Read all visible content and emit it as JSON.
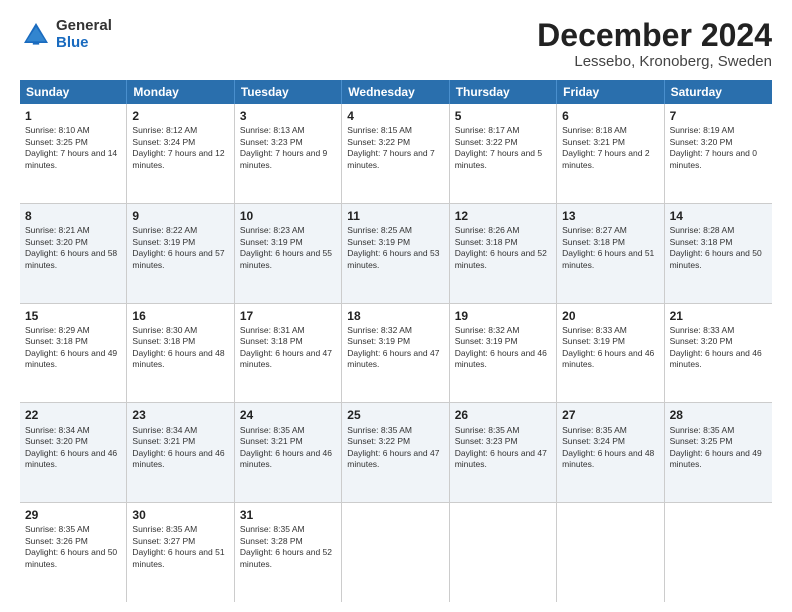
{
  "header": {
    "logo_general": "General",
    "logo_blue": "Blue",
    "title": "December 2024",
    "subtitle": "Lessebo, Kronoberg, Sweden"
  },
  "days": [
    "Sunday",
    "Monday",
    "Tuesday",
    "Wednesday",
    "Thursday",
    "Friday",
    "Saturday"
  ],
  "weeks": [
    [
      {
        "day": "1",
        "sunrise": "Sunrise: 8:10 AM",
        "sunset": "Sunset: 3:25 PM",
        "daylight": "Daylight: 7 hours and 14 minutes."
      },
      {
        "day": "2",
        "sunrise": "Sunrise: 8:12 AM",
        "sunset": "Sunset: 3:24 PM",
        "daylight": "Daylight: 7 hours and 12 minutes."
      },
      {
        "day": "3",
        "sunrise": "Sunrise: 8:13 AM",
        "sunset": "Sunset: 3:23 PM",
        "daylight": "Daylight: 7 hours and 9 minutes."
      },
      {
        "day": "4",
        "sunrise": "Sunrise: 8:15 AM",
        "sunset": "Sunset: 3:22 PM",
        "daylight": "Daylight: 7 hours and 7 minutes."
      },
      {
        "day": "5",
        "sunrise": "Sunrise: 8:17 AM",
        "sunset": "Sunset: 3:22 PM",
        "daylight": "Daylight: 7 hours and 5 minutes."
      },
      {
        "day": "6",
        "sunrise": "Sunrise: 8:18 AM",
        "sunset": "Sunset: 3:21 PM",
        "daylight": "Daylight: 7 hours and 2 minutes."
      },
      {
        "day": "7",
        "sunrise": "Sunrise: 8:19 AM",
        "sunset": "Sunset: 3:20 PM",
        "daylight": "Daylight: 7 hours and 0 minutes."
      }
    ],
    [
      {
        "day": "8",
        "sunrise": "Sunrise: 8:21 AM",
        "sunset": "Sunset: 3:20 PM",
        "daylight": "Daylight: 6 hours and 58 minutes."
      },
      {
        "day": "9",
        "sunrise": "Sunrise: 8:22 AM",
        "sunset": "Sunset: 3:19 PM",
        "daylight": "Daylight: 6 hours and 57 minutes."
      },
      {
        "day": "10",
        "sunrise": "Sunrise: 8:23 AM",
        "sunset": "Sunset: 3:19 PM",
        "daylight": "Daylight: 6 hours and 55 minutes."
      },
      {
        "day": "11",
        "sunrise": "Sunrise: 8:25 AM",
        "sunset": "Sunset: 3:19 PM",
        "daylight": "Daylight: 6 hours and 53 minutes."
      },
      {
        "day": "12",
        "sunrise": "Sunrise: 8:26 AM",
        "sunset": "Sunset: 3:18 PM",
        "daylight": "Daylight: 6 hours and 52 minutes."
      },
      {
        "day": "13",
        "sunrise": "Sunrise: 8:27 AM",
        "sunset": "Sunset: 3:18 PM",
        "daylight": "Daylight: 6 hours and 51 minutes."
      },
      {
        "day": "14",
        "sunrise": "Sunrise: 8:28 AM",
        "sunset": "Sunset: 3:18 PM",
        "daylight": "Daylight: 6 hours and 50 minutes."
      }
    ],
    [
      {
        "day": "15",
        "sunrise": "Sunrise: 8:29 AM",
        "sunset": "Sunset: 3:18 PM",
        "daylight": "Daylight: 6 hours and 49 minutes."
      },
      {
        "day": "16",
        "sunrise": "Sunrise: 8:30 AM",
        "sunset": "Sunset: 3:18 PM",
        "daylight": "Daylight: 6 hours and 48 minutes."
      },
      {
        "day": "17",
        "sunrise": "Sunrise: 8:31 AM",
        "sunset": "Sunset: 3:18 PM",
        "daylight": "Daylight: 6 hours and 47 minutes."
      },
      {
        "day": "18",
        "sunrise": "Sunrise: 8:32 AM",
        "sunset": "Sunset: 3:19 PM",
        "daylight": "Daylight: 6 hours and 47 minutes."
      },
      {
        "day": "19",
        "sunrise": "Sunrise: 8:32 AM",
        "sunset": "Sunset: 3:19 PM",
        "daylight": "Daylight: 6 hours and 46 minutes."
      },
      {
        "day": "20",
        "sunrise": "Sunrise: 8:33 AM",
        "sunset": "Sunset: 3:19 PM",
        "daylight": "Daylight: 6 hours and 46 minutes."
      },
      {
        "day": "21",
        "sunrise": "Sunrise: 8:33 AM",
        "sunset": "Sunset: 3:20 PM",
        "daylight": "Daylight: 6 hours and 46 minutes."
      }
    ],
    [
      {
        "day": "22",
        "sunrise": "Sunrise: 8:34 AM",
        "sunset": "Sunset: 3:20 PM",
        "daylight": "Daylight: 6 hours and 46 minutes."
      },
      {
        "day": "23",
        "sunrise": "Sunrise: 8:34 AM",
        "sunset": "Sunset: 3:21 PM",
        "daylight": "Daylight: 6 hours and 46 minutes."
      },
      {
        "day": "24",
        "sunrise": "Sunrise: 8:35 AM",
        "sunset": "Sunset: 3:21 PM",
        "daylight": "Daylight: 6 hours and 46 minutes."
      },
      {
        "day": "25",
        "sunrise": "Sunrise: 8:35 AM",
        "sunset": "Sunset: 3:22 PM",
        "daylight": "Daylight: 6 hours and 47 minutes."
      },
      {
        "day": "26",
        "sunrise": "Sunrise: 8:35 AM",
        "sunset": "Sunset: 3:23 PM",
        "daylight": "Daylight: 6 hours and 47 minutes."
      },
      {
        "day": "27",
        "sunrise": "Sunrise: 8:35 AM",
        "sunset": "Sunset: 3:24 PM",
        "daylight": "Daylight: 6 hours and 48 minutes."
      },
      {
        "day": "28",
        "sunrise": "Sunrise: 8:35 AM",
        "sunset": "Sunset: 3:25 PM",
        "daylight": "Daylight: 6 hours and 49 minutes."
      }
    ],
    [
      {
        "day": "29",
        "sunrise": "Sunrise: 8:35 AM",
        "sunset": "Sunset: 3:26 PM",
        "daylight": "Daylight: 6 hours and 50 minutes."
      },
      {
        "day": "30",
        "sunrise": "Sunrise: 8:35 AM",
        "sunset": "Sunset: 3:27 PM",
        "daylight": "Daylight: 6 hours and 51 minutes."
      },
      {
        "day": "31",
        "sunrise": "Sunrise: 8:35 AM",
        "sunset": "Sunset: 3:28 PM",
        "daylight": "Daylight: 6 hours and 52 minutes."
      },
      null,
      null,
      null,
      null
    ]
  ]
}
